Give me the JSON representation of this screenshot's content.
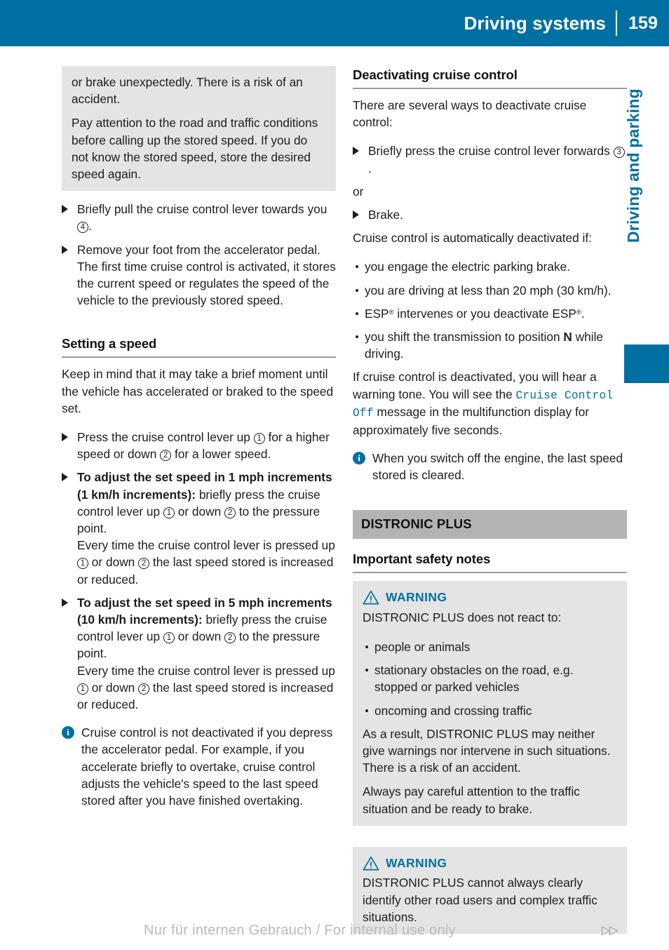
{
  "header": {
    "title": "Driving systems",
    "page_number": "159"
  },
  "chapter_tab": {
    "label": "Driving and parking",
    "color": "#0070a3"
  },
  "left_column": {
    "warning_box_top": {
      "paragraphs": [
        "or brake unexpectedly. There is a risk of an accident.",
        "Pay attention to the road and traffic conditions before calling up the stored speed. If you do not know the stored speed, store the desired speed again."
      ]
    },
    "steps": [
      {
        "text_before": "Briefly pull the cruise control lever towards you ",
        "circle": "4",
        "text_after": "."
      },
      {
        "text_before": "Remove your foot from the accelerator pedal.",
        "continuation": "The first time cruise control is activated, it stores the current speed or regulates the speed of the vehicle to the previously stored speed."
      }
    ],
    "heading_setting_speed": "Setting a speed",
    "intro_paragraph": "Keep in mind that it may take a brief moment until the vehicle has accelerated or braked to the speed set.",
    "step_press": {
      "p1": "Press the cruise control lever up ",
      "c1": "1",
      "p2": " for a higher speed or down ",
      "c2": "2",
      "p3": " for a lower speed."
    },
    "step_1mph": {
      "bold_lead_a": "To adjust the set speed in 1 mph increments",
      "bold_lead_b": " (1 km/h increments):",
      "p1": " briefly press the cruise control lever up ",
      "c1": "1",
      "p2": " or down ",
      "c2": "2",
      "p3": " to the pressure point.",
      "cont_p1": "Every time the cruise control lever is pressed up ",
      "cont_c1": "1",
      "cont_p2": " or down ",
      "cont_c2": "2",
      "cont_p3": " the last speed stored is increased or reduced."
    },
    "step_5mph": {
      "bold_lead_a": "To adjust the set speed in 5 mph increments",
      "bold_lead_b": " (10 km/h increments):",
      "p1": " briefly press the cruise control lever up ",
      "c1": "1",
      "p2": " or down ",
      "c2": "2",
      "p3": " to the pressure point.",
      "cont_p1": "Every time the cruise control lever is pressed up ",
      "cont_c1": "1",
      "cont_p2": " or down ",
      "cont_c2": "2",
      "cont_p3": " the last speed stored is increased or reduced."
    },
    "note": "Cruise control is not deactivated if you depress the accelerator pedal. For example, if you accelerate briefly to overtake, cruise control adjusts the vehicle's speed to the last speed stored after you have finished overtaking."
  },
  "right_column": {
    "heading_deactivating": "Deactivating cruise control",
    "intro": "There are several ways to deactivate cruise control:",
    "step_press_forward": {
      "p1": "Briefly press the cruise control lever forwards ",
      "c1": "3",
      "p2": "."
    },
    "or_label": "or",
    "step_brake": "Brake.",
    "auto_deactivated_lead": "Cruise control is automatically deactivated if:",
    "auto_deactivated_items": [
      "you engage the electric parking brake.",
      "you are driving at less than 20 mph (30 km/h).",
      "ESP® intervenes or you deactivate ESP®.",
      "you shift the transmission to position N while driving."
    ],
    "esp_item": {
      "a": "ESP",
      "reg": "®",
      "b": " intervenes or you deactivate ESP",
      "reg2": "®",
      "c": "."
    },
    "transmission_item": {
      "a": "you shift the transmission to position ",
      "bold": "N",
      "b": " while driving."
    },
    "warning_tone_para": {
      "a": "If cruise control is deactivated, you will hear a warning tone. You will see the ",
      "mono": "Cruise Control Off",
      "b": " message in the multifunction display for approximately five seconds."
    },
    "note": "When you switch off the engine, the last speed stored is cleared.",
    "section_heading": "DISTRONIC PLUS",
    "heading_safety_notes": "Important safety notes",
    "warning_1": {
      "label": "WARNING",
      "lead": "DISTRONIC PLUS does not react to:",
      "items": [
        "people or animals",
        "stationary obstacles on the road, e.g. stopped or parked vehicles",
        "oncoming and crossing traffic"
      ],
      "p_after_1": "As a result, DISTRONIC PLUS may neither give warnings nor intervene in such situations. There is a risk of an accident.",
      "p_after_2": "Always pay careful attention to the traffic situation and be ready to brake."
    },
    "warning_2": {
      "label": "WARNING",
      "body": "DISTRONIC PLUS cannot always clearly identify other road users and complex traffic situations."
    }
  },
  "footer": {
    "watermark": "Nur für internen Gebrauch / For internal use only",
    "arrows": "▷▷"
  }
}
